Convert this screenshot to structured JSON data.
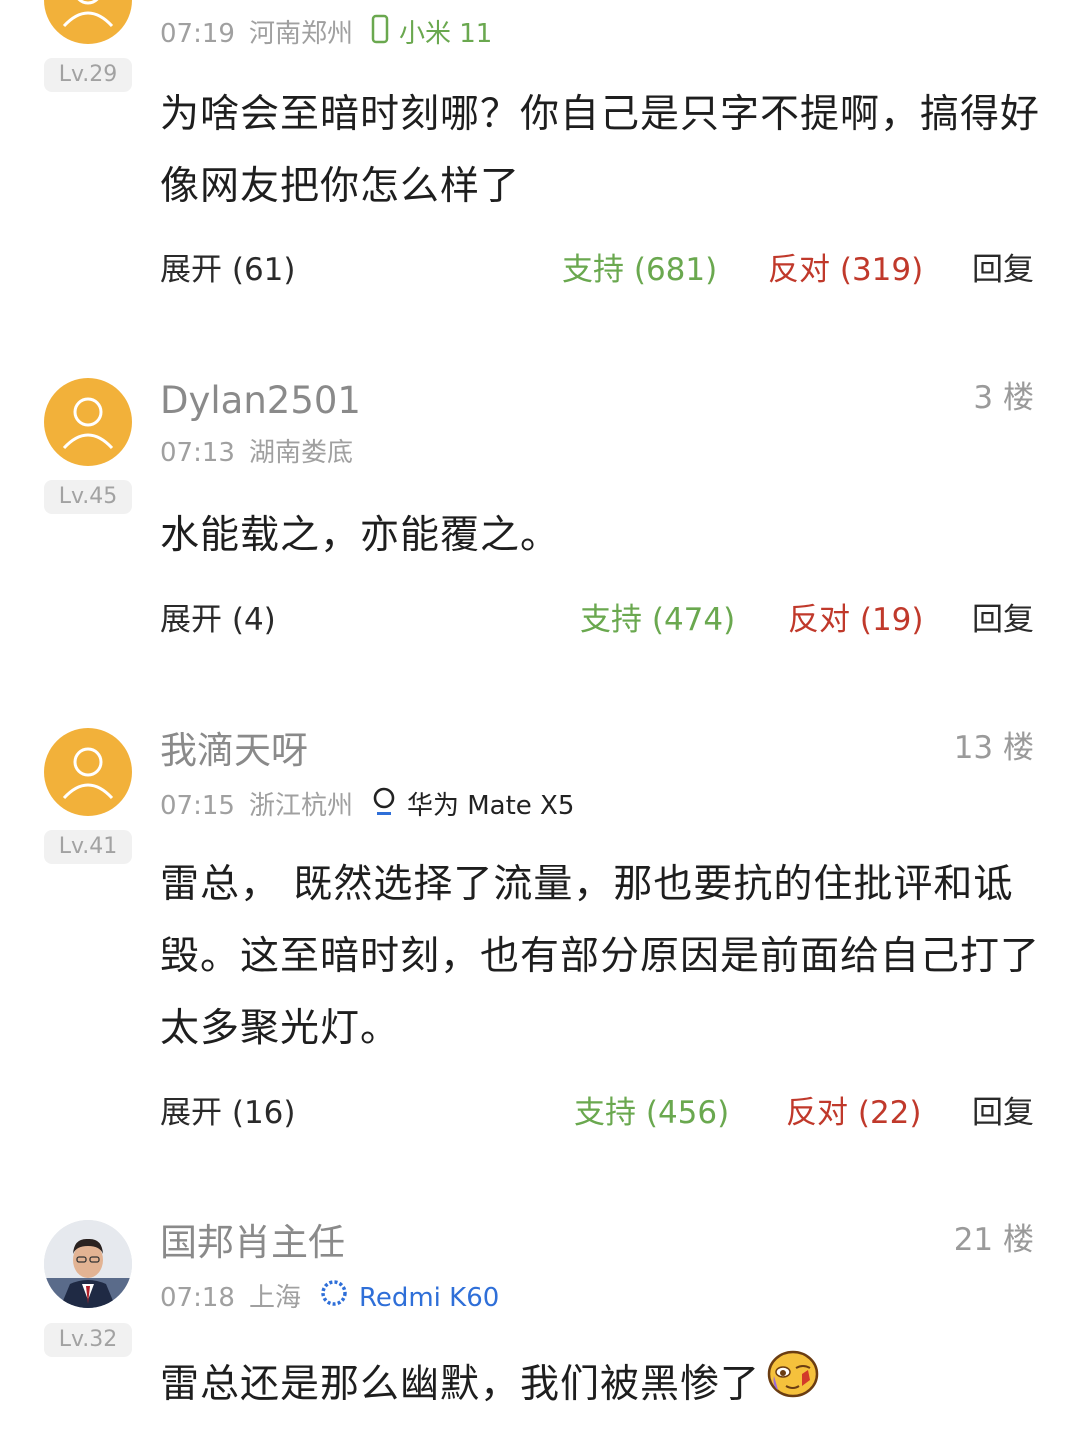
{
  "comments": [
    {
      "level": "Lv.29",
      "time": "07:19",
      "location": "河南郑州",
      "device": "小米 11",
      "body": "为啥会至暗时刻哪？你自己是只字不提啊，搞得好像网友把你怎么样了",
      "expand": "展开 (61)",
      "support": "支持 (681)",
      "oppose": "反对 (319)",
      "reply": "回复",
      "colors": {
        "device": "#6aa84f"
      }
    },
    {
      "username": "Dylan2501",
      "floor": "3 楼",
      "level": "Lv.45",
      "time": "07:13",
      "location": "湖南娄底",
      "body": "水能载之，亦能覆之。",
      "expand": "展开 (4)",
      "support": "支持 (474)",
      "oppose": "反对 (19)",
      "reply": "回复"
    },
    {
      "username": "我滴天呀",
      "floor": "13 楼",
      "level": "Lv.41",
      "time": "07:15",
      "location": "浙江杭州",
      "device": "华为 Mate X5",
      "body": "雷总， 既然选择了流量，那也要抗的住批评和诋毁。这至暗时刻，也有部分原因是前面给自己打了太多聚光灯。",
      "expand": "展开 (16)",
      "support": "支持 (456)",
      "oppose": "反对 (22)",
      "reply": "回复"
    },
    {
      "username": "国邦肖主任",
      "floor": "21 楼",
      "level": "Lv.32",
      "time": "07:18",
      "location": "上海",
      "device": "Redmi K60",
      "body": "雷总还是那么幽默，我们被黑惨了",
      "colors": {
        "device": "#2f6fd8"
      }
    }
  ],
  "icons": {
    "avatar": "default-user-avatar-icon",
    "phone": "phone-icon",
    "huawei": "huawei-ring-icon",
    "redmi": "redmi-ring-icon",
    "emoji": "crying-laughing-emoji-icon"
  },
  "colors": {
    "avatar_bg": "#f2b13a",
    "support": "#6aa84f",
    "oppose": "#c0392b"
  }
}
